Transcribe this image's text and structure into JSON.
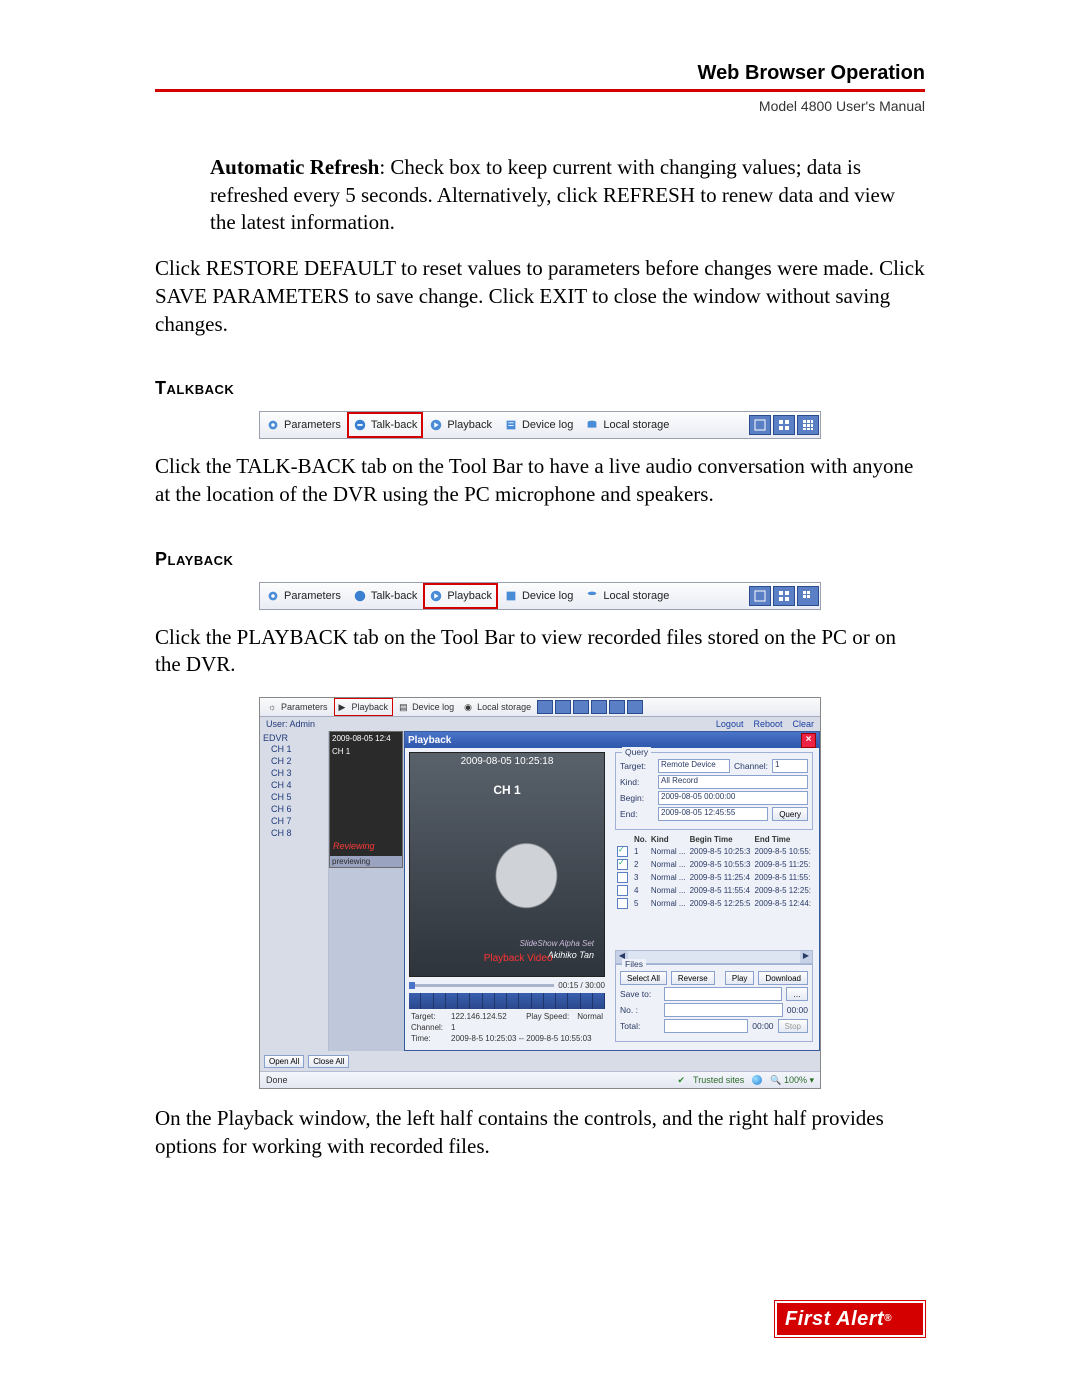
{
  "header": {
    "title": "Web Browser Operation",
    "subtitle": "Model 4800 User's Manual"
  },
  "paragraphs": {
    "auto_refresh_label": "Automatic Refresh",
    "auto_refresh_rest": ": Check box to keep current with changing values; data is refreshed every 5 seconds. Alternatively, click REFRESH to renew data and view the latest information.",
    "restore": "Click RESTORE DEFAULT to reset values to parameters before changes were made. Click SAVE PARAMETERS to save change. Click EXIT to close the window without saving changes.",
    "talkback_head": "Talkback",
    "talkback_body": "Click the TALK-BACK tab on the Tool Bar to have a live audio conversation with anyone at the location of the DVR using the PC microphone and speakers.",
    "playback_head": "Playback",
    "playback_body": "Click the PLAYBACK tab on the Tool Bar to view recorded files stored on the PC or on the DVR.",
    "playback_descr": "On the Playback window, the left half contains the controls, and the right half provides options for working with recorded files."
  },
  "toolbar": {
    "parameters": "Parameters",
    "talkback": "Talk-back",
    "playback": "Playback",
    "devicelog": "Device log",
    "localstorage": "Local storage"
  },
  "pb": {
    "user_label": "User: Admin",
    "logout": "Logout",
    "reboot": "Reboot",
    "clear": "Clear",
    "tree_root": "EDVR",
    "channels": [
      "CH 1",
      "CH 2",
      "CH 3",
      "CH 4",
      "CH 5",
      "CH 6",
      "CH 7",
      "CH 8"
    ],
    "thumb_time": "2009-08-05 12:4",
    "thumb_ch": "CH 1",
    "thumb_review": "Reviewing",
    "thumb_bottom": "previewing",
    "win_title": "Playback",
    "video_ts": "2009-08-05 10:25:18",
    "video_ch": "CH 1",
    "video_red": "Playback Video",
    "video_sig1": "SlideShow Alpha Set",
    "video_sig2": "Akihiko Tan",
    "seek_time": "00:15 / 30:00",
    "meta": {
      "target_l": "Target:",
      "target_v": "122.146.124.52",
      "speed_l": "Play Speed:",
      "speed_v": "Normal",
      "channel_l": "Channel:",
      "channel_v": "1",
      "time_l": "Time:",
      "time_v": "2009-8-5 10:25:03 -- 2009-8-5 10:55:03"
    },
    "query": {
      "group": "Query",
      "target_l": "Target:",
      "target_v": "Remote Device",
      "channel_l": "Channel:",
      "channel_v": "1",
      "kind_l": "Kind:",
      "kind_v": "All Record",
      "begin_l": "Begin:",
      "begin_v": "2009-08-05 00:00:00",
      "end_l": "End:",
      "end_v": "2009-08-05 12:45:55",
      "btn": "Query"
    },
    "table": {
      "h_no": "No.",
      "h_kind": "Kind",
      "h_begin": "Begin Time",
      "h_end": "End Time",
      "rows": [
        {
          "no": "1",
          "chk": true,
          "kind": "Normal ...",
          "begin": "2009-8-5 10:25:3",
          "end": "2009-8-5 10:55:"
        },
        {
          "no": "2",
          "chk": true,
          "kind": "Normal ...",
          "begin": "2009-8-5 10:55:3",
          "end": "2009-8-5 11:25:"
        },
        {
          "no": "3",
          "chk": false,
          "kind": "Normal ...",
          "begin": "2009-8-5 11:25:4",
          "end": "2009-8-5 11:55:"
        },
        {
          "no": "4",
          "chk": false,
          "kind": "Normal ...",
          "begin": "2009-8-5 11:55:4",
          "end": "2009-8-5 12:25:"
        },
        {
          "no": "5",
          "chk": false,
          "kind": "Normal ...",
          "begin": "2009-8-5 12:25:5",
          "end": "2009-8-5 12:44:"
        }
      ]
    },
    "files": {
      "group": "Files",
      "select_all": "Select All",
      "reverse": "Reverse",
      "play": "Play",
      "download": "Download",
      "save_to": "Save to:",
      "no_l": "No. :",
      "total_l": "Total:",
      "zero": "00:00",
      "stop": "Stop"
    },
    "footer": {
      "open_all": "Open All",
      "close_all": "Close All",
      "done": "Done",
      "trusted": "Trusted sites",
      "zoom": "100%"
    }
  },
  "logo": "First Alert"
}
